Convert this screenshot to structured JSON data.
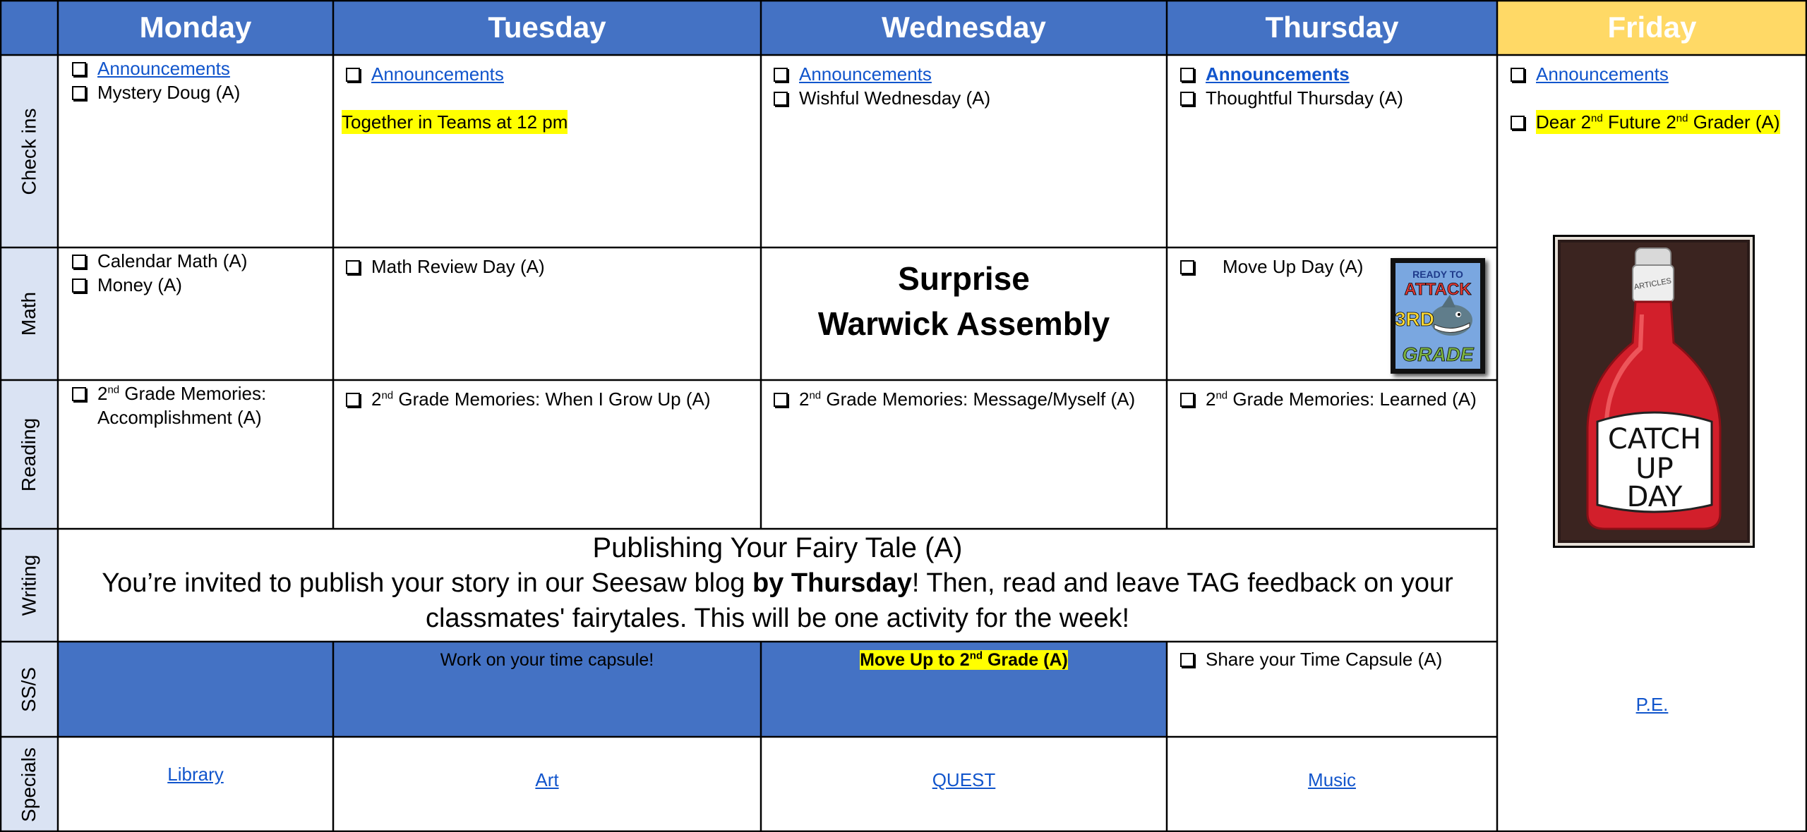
{
  "headers": {
    "monday": "Monday",
    "tuesday": "Tuesday",
    "wednesday": "Wednesday",
    "thursday": "Thursday",
    "friday": "Friday"
  },
  "rows": {
    "checkins": "Check ins",
    "math": "Math",
    "reading": "Reading",
    "writing": "Writing",
    "sss": "SS/S",
    "specials": "Specials"
  },
  "checkins": {
    "mon_announcements": "Announcements",
    "mon_item": "Mystery Doug (A)",
    "tue_announcements": "Announcements",
    "tue_teams": "Together in Teams at 12 pm",
    "wed_announcements": "Announcements",
    "wed_item": "Wishful Wednesday (A)",
    "thu_announcements": "Announcements",
    "thu_item": "Thoughtful Thursday (A)",
    "fri_announcements": "Announcements",
    "fri_item_pre": "Dear 2",
    "fri_item_sup1": "nd",
    "fri_item_mid": " Future 2",
    "fri_item_sup2": "nd",
    "fri_item_post": " Grader (A)"
  },
  "math": {
    "mon_item1": "Calendar Math (A)",
    "mon_item2": "Money (A)",
    "tue_item": "Math Review Day (A)",
    "wed_line1": "Surprise",
    "wed_line2": "Warwick Assembly",
    "thu_item": "Move Up Day (A)",
    "thu_badge_line1": "READY TO",
    "thu_badge_line2": "ATTACK",
    "thu_badge_line3": "3RD",
    "thu_badge_line4": "GRADE"
  },
  "reading": {
    "num": "2",
    "sup": "nd",
    "mon_text": " Grade Memories:",
    "mon_text2": "Accomplishment (A)",
    "tue_text": " Grade Memories: When I Grow Up (A)",
    "wed_text": " Grade Memories: Message/Myself (A)",
    "thu_text": " Grade Memories: Learned (A)"
  },
  "writing": {
    "title": "Publishing Your Fairy Tale (A)",
    "line1_pre": "You’re invited to publish your story in our Seesaw blog ",
    "line1_bold": "by Thursday",
    "line1_post": "! Then, read and leave TAG feedback on your",
    "line2": "classmates' fairytales. This will be one activity for the week!"
  },
  "sss": {
    "tue_text": "Work on your time capsule!",
    "wed_pre": "Move Up to 2",
    "wed_sup": "nd",
    "wed_post": " Grade (A)",
    "thu_item": "Share your Time Capsule (A)"
  },
  "specials": {
    "mon": "Library",
    "tue": "Art",
    "wed": "QUEST",
    "thu": "Music",
    "fri": "P.E."
  },
  "friday_image": {
    "cap_label": "ARTICLES",
    "line1": "CATCH",
    "line2": "UP",
    "line3": "DAY"
  },
  "colors": {
    "header_blue": "#4472c4",
    "friday_yellow": "#ffd966",
    "side_blue": "#dae3f3",
    "highlight": "#ffff00",
    "link": "#1155cc"
  }
}
